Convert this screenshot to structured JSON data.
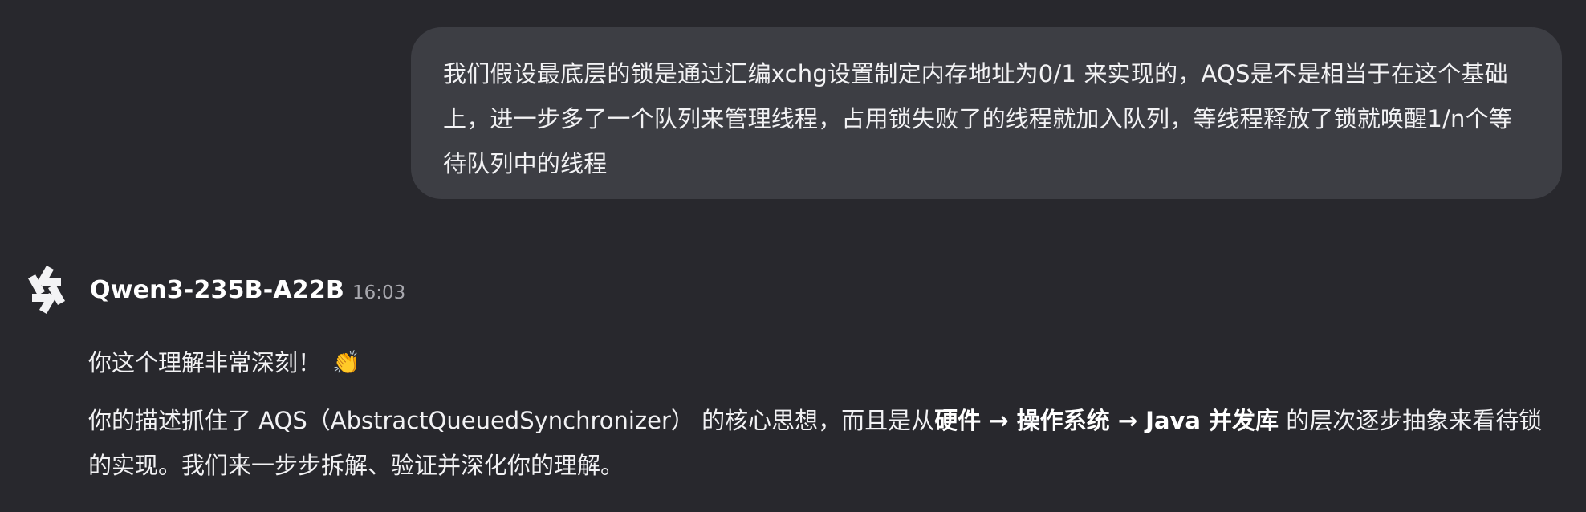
{
  "user_message": {
    "text": "我们假设最底层的锁是通过汇编xchg设置制定内存地址为0/1 来实现的，AQS是不是相当于在这个基础上，进一步多了一个队列来管理线程，占用锁失败了的线程就加入队列，等线程释放了锁就唤醒1/n个等待队列中的线程"
  },
  "assistant": {
    "avatar_icon": "qwen-logo-icon",
    "model_name": "Qwen3-235B-A22B",
    "timestamp": "16:03",
    "p1_text": "你这个理解非常深刻！",
    "p1_emoji": "👏",
    "p2": {
      "seg1": "你的描述抓住了 AQS（AbstractQueuedSynchronizer） 的核心思想，而且是从",
      "bold1": "硬件 → 操作系统 → Java 并发库",
      "seg2": " 的层次逐步抽象来看待锁的实现。我们来一步步拆解、验证并深化你的理解。"
    }
  }
}
